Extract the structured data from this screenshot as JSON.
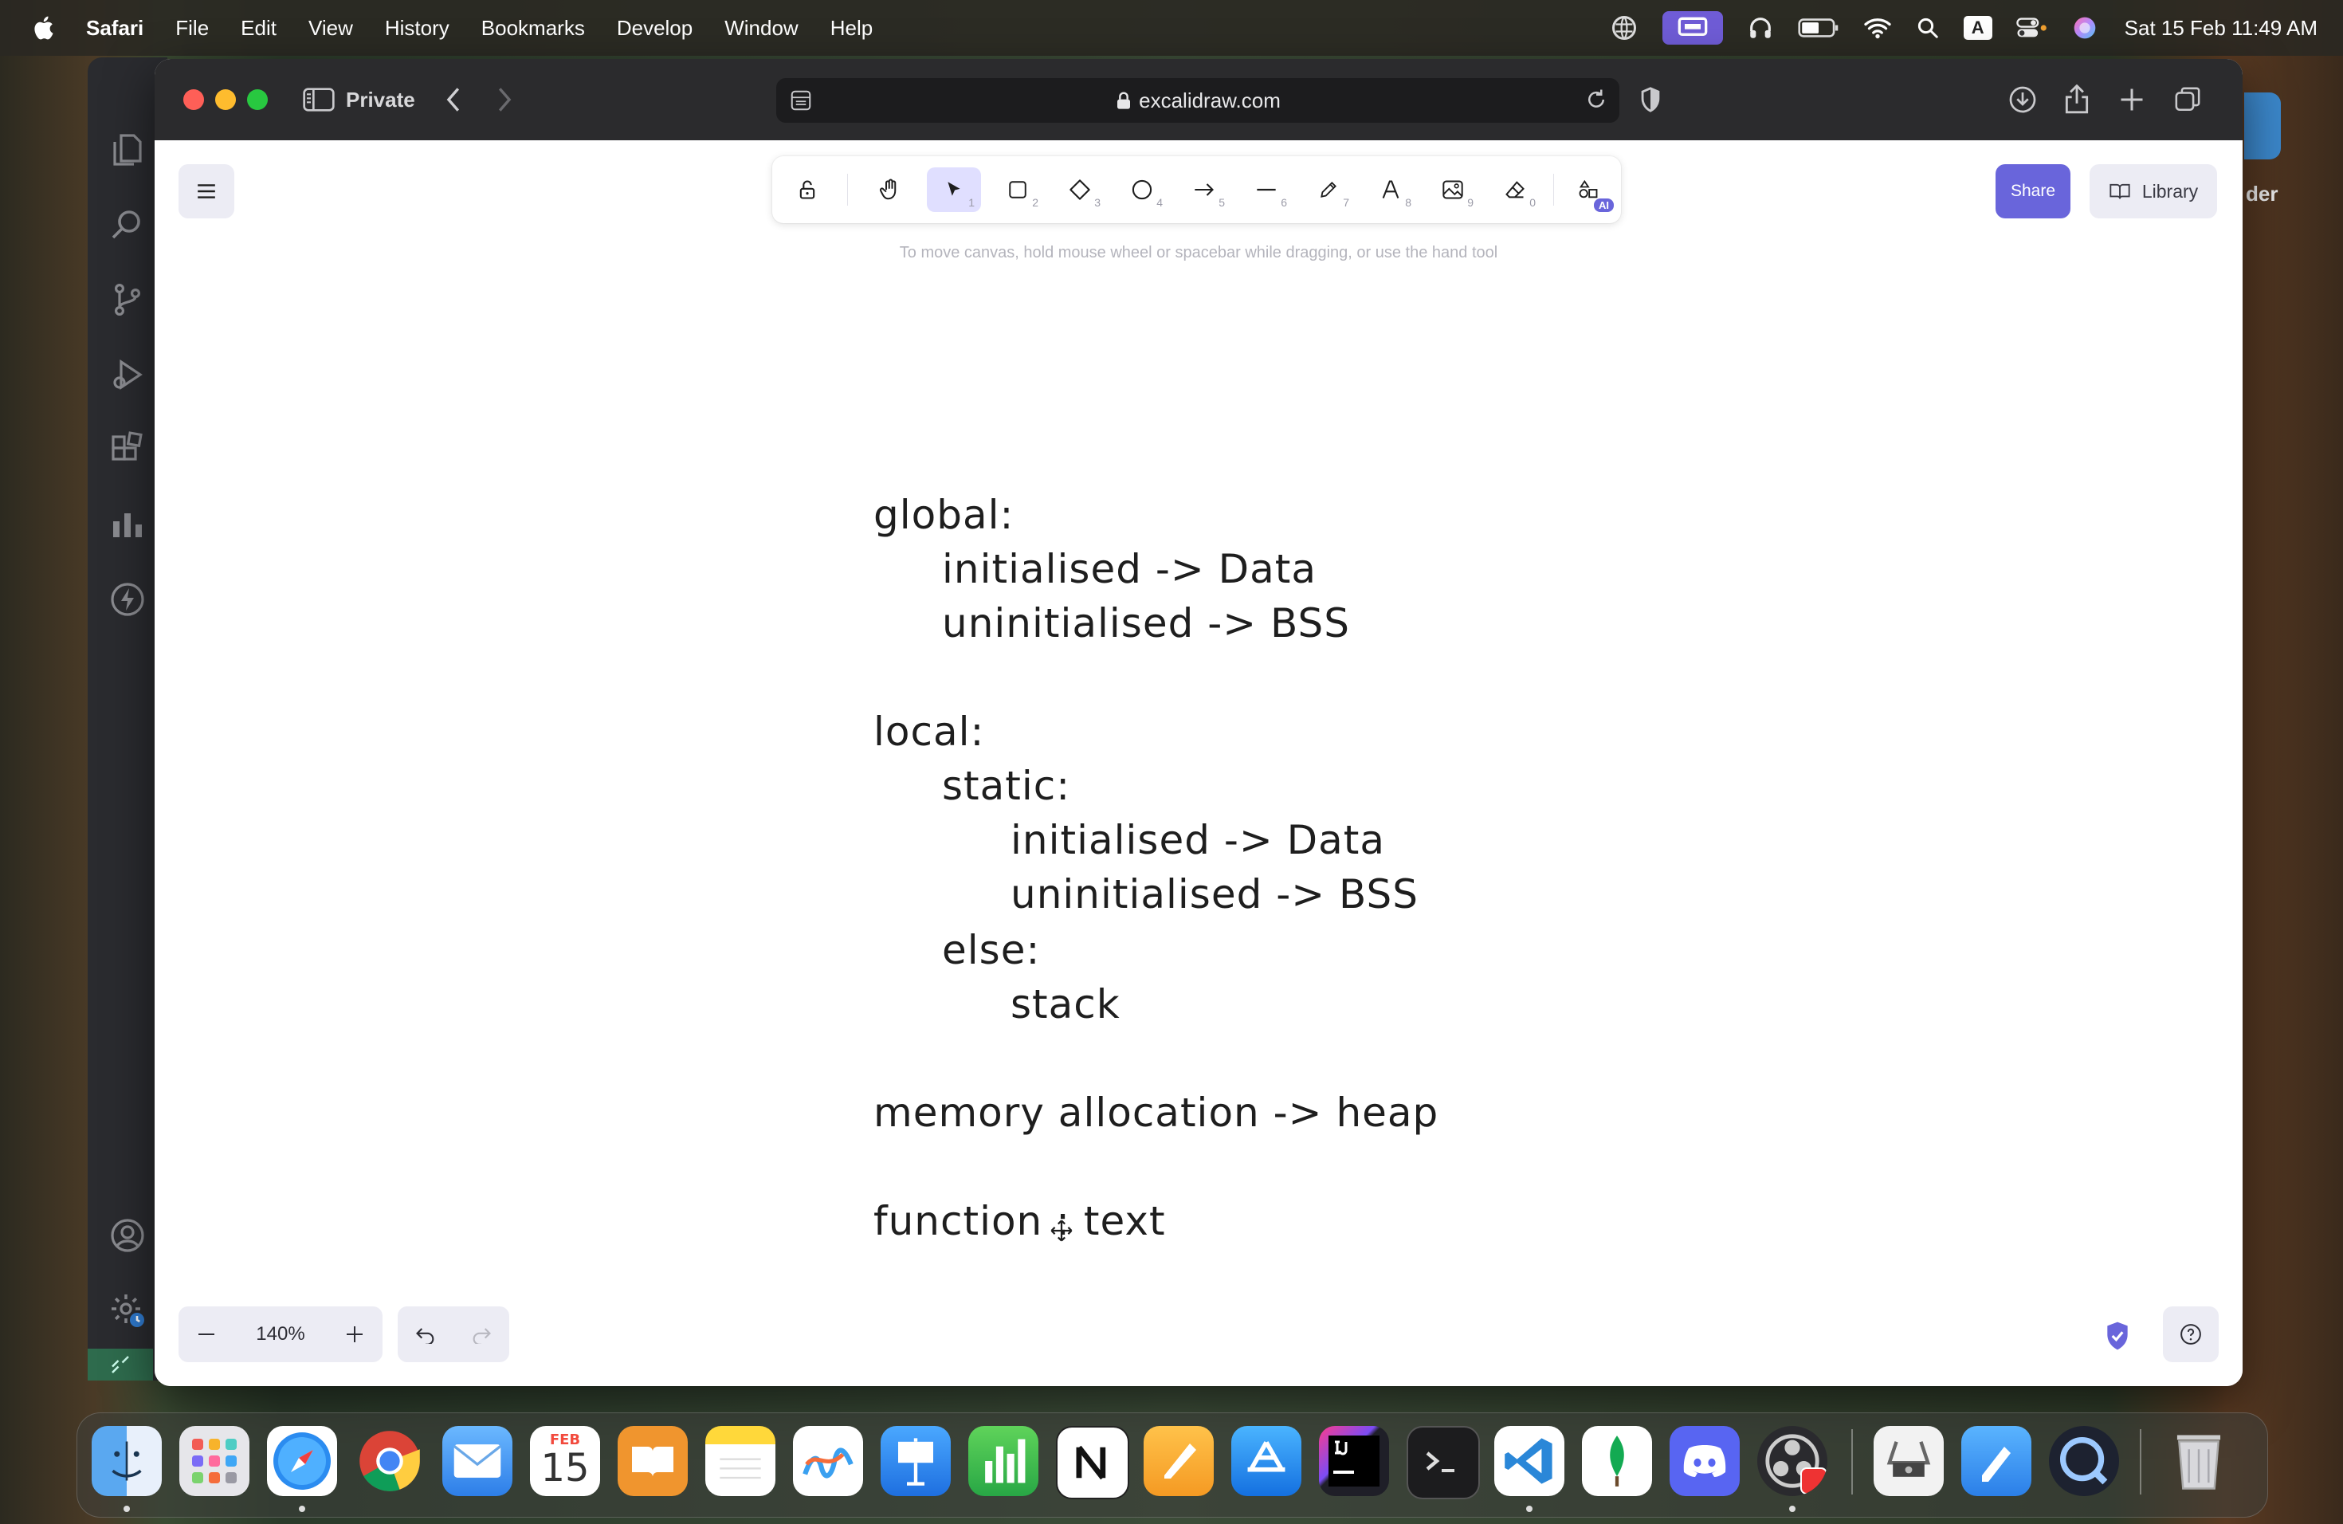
{
  "menubar": {
    "app_name": "Safari",
    "items": [
      "File",
      "Edit",
      "View",
      "History",
      "Bookmarks",
      "Develop",
      "Window",
      "Help"
    ],
    "clock": "Sat 15 Feb  11:49 AM",
    "input_indicator": "A"
  },
  "browser": {
    "mode_label": "Private",
    "url": "excalidraw.com"
  },
  "excalidraw": {
    "hint": "To move canvas, hold mouse wheel or spacebar while dragging, or use the hand tool",
    "share_label": "Share",
    "library_label": "Library",
    "zoom": "140%",
    "ai_badge": "AI",
    "tools": [
      {
        "name": "lock",
        "key": ""
      },
      {
        "name": "hand",
        "key": ""
      },
      {
        "name": "selection",
        "key": "1"
      },
      {
        "name": "rectangle",
        "key": "2"
      },
      {
        "name": "diamond",
        "key": "3"
      },
      {
        "name": "ellipse",
        "key": "4"
      },
      {
        "name": "arrow",
        "key": "5"
      },
      {
        "name": "line",
        "key": "6"
      },
      {
        "name": "draw",
        "key": "7"
      },
      {
        "name": "text",
        "key": "8"
      },
      {
        "name": "image",
        "key": "9"
      },
      {
        "name": "eraser",
        "key": "0"
      }
    ],
    "drawing_lines": [
      "global:",
      "initialised -> Data",
      "uninitialised -> BSS",
      "local:",
      "static:",
      "initialised -> Data",
      "uninitialised -> BSS",
      "else:",
      "stack",
      "memory allocation -> heap",
      "function : text"
    ]
  },
  "calendar": {
    "month": "FEB",
    "day": "15"
  },
  "background_text": "der"
}
